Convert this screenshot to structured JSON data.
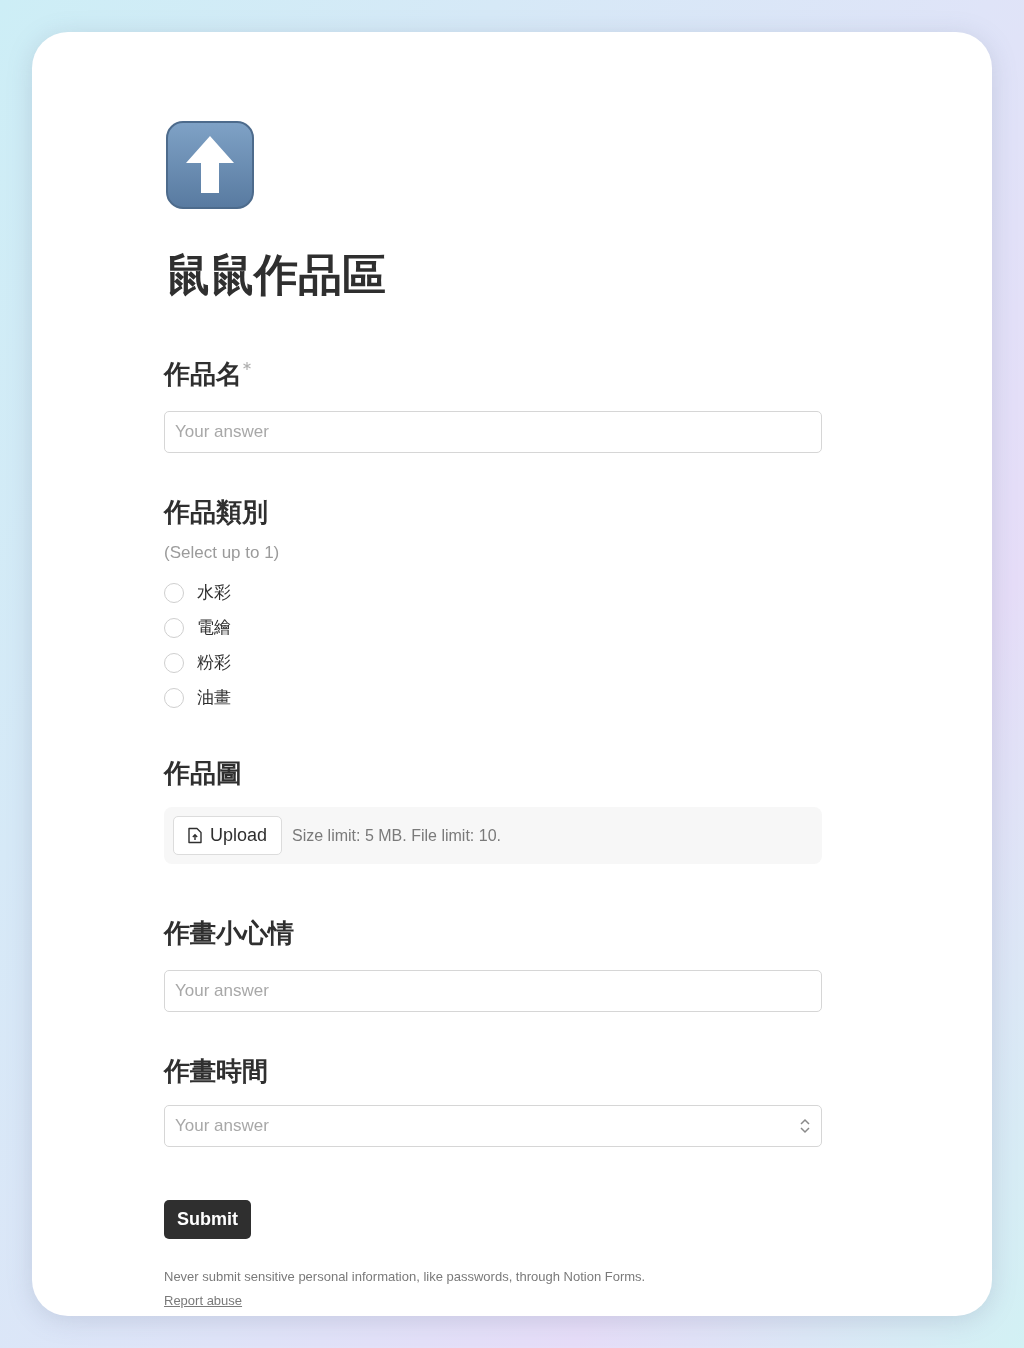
{
  "form": {
    "title": "鼠鼠作品區",
    "questions": [
      {
        "kind": "text",
        "label": "作品名",
        "required": true,
        "placeholder": "Your answer"
      },
      {
        "kind": "choice",
        "label": "作品類別",
        "required": false,
        "hint": "(Select up to 1)",
        "options": [
          {
            "label": "水彩",
            "selected": false
          },
          {
            "label": "電繪",
            "selected": false
          },
          {
            "label": "粉彩",
            "selected": false
          },
          {
            "label": "油畫",
            "selected": false
          }
        ]
      },
      {
        "kind": "file",
        "label": "作品圖",
        "required": false,
        "button": "Upload",
        "note": "Size limit: 5 MB. File limit: 10."
      },
      {
        "kind": "text",
        "label": "作畫小心情",
        "required": false,
        "placeholder": "Your answer"
      },
      {
        "kind": "select",
        "label": "作畫時間",
        "required": false,
        "placeholder": "Your answer"
      }
    ],
    "submit": "Submit",
    "disclaimer": "Never submit sensitive personal information, like passwords, through Notion Forms.",
    "report_link": "Report abuse"
  }
}
